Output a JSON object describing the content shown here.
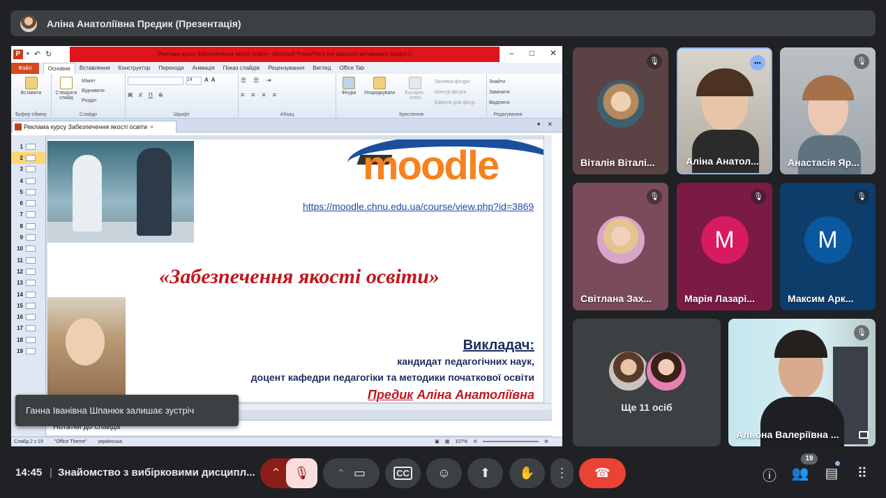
{
  "presenter": {
    "name": "Аліна Анатоліївна Предик (Презентація)"
  },
  "ppt": {
    "title": "Реклама курсу Забезпечення якості освіти - Microsoft PowerPoint (не вдалося активувати продукт)",
    "tabs": [
      "Файл",
      "Основне",
      "Вставлення",
      "Конструктор",
      "Переходи",
      "Анімація",
      "Показ слайдів",
      "Рецензування",
      "Вигляд",
      "Office Tab"
    ],
    "ribbon_groups": [
      {
        "label": "Буфер обміну",
        "items": [
          "Вставити"
        ]
      },
      {
        "label": "Слайди",
        "items": [
          "Створити слайд",
          "Макет",
          "Відновити",
          "Розділ"
        ]
      },
      {
        "label": "Шрифт",
        "items": [
          "14"
        ]
      },
      {
        "label": "Абзац",
        "items": []
      },
      {
        "label": "Креслення",
        "items": [
          "Фігури",
          "Упорядкувати",
          "Експрес-стилі",
          "Заливка фігури",
          "Контур фігури",
          "Ефекти для фігур"
        ]
      },
      {
        "label": "Редагування",
        "items": [
          "Знайти",
          "Замінити",
          "Виділити"
        ]
      }
    ],
    "doc_tab": "Реклама курсу Забезпечення якості освіти",
    "slide_numbers": [
      "1",
      "2",
      "3",
      "4",
      "5",
      "6",
      "7",
      "8",
      "9",
      "10",
      "11",
      "12",
      "13",
      "14",
      "15",
      "16",
      "17",
      "18",
      "19"
    ],
    "selected_slide": "2",
    "notes_placeholder": "Нотатки до слайда",
    "status": {
      "slide": "Слайд 2 з 19",
      "theme": "\"Office Theme\"",
      "language": "українська",
      "zoom": "107%"
    }
  },
  "slide": {
    "logo_text": "moodle",
    "link": "https://moodle.chnu.edu.ua/course/view.php?id=3869",
    "title": "«Забезпечення якості освіти»",
    "lecturer_label": "Викладач:",
    "line1": "кандидат педагогічних наук,",
    "line2": "доцент кафедри педагогіки та методики початкової освіти",
    "name_surname": "Предик",
    "name_rest": " Аліна Анатоліївна"
  },
  "toast": "Ганна Іванівна Шпанюк залишає зустріч",
  "participants": [
    {
      "name": "Віталія Віталі...",
      "type": "photo",
      "muted": true
    },
    {
      "name": "Аліна Анатол...",
      "type": "camera",
      "speaking": true
    },
    {
      "name": "Анастасія Яр...",
      "type": "camera",
      "muted": true
    },
    {
      "name": "Світлана Зах...",
      "type": "photo",
      "muted": true
    },
    {
      "name": "Марія Лазарі...",
      "type": "letter",
      "letter": "M",
      "color": "#c2185b",
      "muted": true
    },
    {
      "name": "Максим Арк...",
      "type": "letter",
      "letter": "M",
      "color": "#0b57a0",
      "muted": true
    }
  ],
  "more_people": "Ще 11 осіб",
  "pinned": {
    "name": "Альона Валеріївна ...",
    "muted": true
  },
  "bottom": {
    "time": "14:45",
    "meeting_title": "Знайомство з вибірковими дисципл...",
    "people_count": "19"
  },
  "colors": {
    "hangup": "#ea4335",
    "mic_off": "#f9dedc",
    "accent": "#8ab4f8"
  }
}
